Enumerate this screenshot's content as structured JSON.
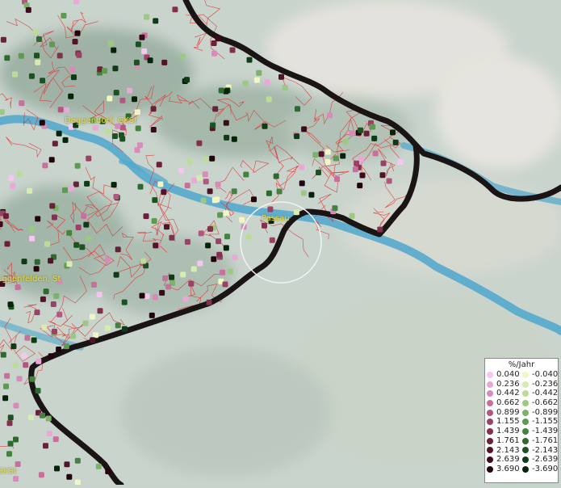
{
  "map": {
    "places": [
      {
        "key": "deggendorf",
        "name": "Deggendorf, GKSt"
      },
      {
        "key": "passau",
        "name": "Passau"
      },
      {
        "key": "eggenfelden",
        "name": "Eggenfelden, St"
      },
      {
        "key": "gkst_bottom",
        "name": "GKSt"
      }
    ]
  },
  "legend": {
    "title": "%/Jahr",
    "positive": [
      {
        "label": "0.040",
        "color": "#f4c6f0"
      },
      {
        "label": "0.236",
        "color": "#e8a8d8"
      },
      {
        "label": "0.442",
        "color": "#d88ab8"
      },
      {
        "label": "0.662",
        "color": "#c8709c"
      },
      {
        "label": "0.899",
        "color": "#b25880"
      },
      {
        "label": "1.155",
        "color": "#9a4266"
      },
      {
        "label": "1.439",
        "color": "#82304e"
      },
      {
        "label": "1.761",
        "color": "#6a2038"
      },
      {
        "label": "2.143",
        "color": "#521428"
      },
      {
        "label": "2.639",
        "color": "#3c0a1a"
      },
      {
        "label": "3.690",
        "color": "#24040c"
      }
    ],
    "negative": [
      {
        "label": "-0.040",
        "color": "#f2f6c2"
      },
      {
        "label": "-0.236",
        "color": "#d8ecb0"
      },
      {
        "label": "-0.442",
        "color": "#bcdc98"
      },
      {
        "label": "-0.662",
        "color": "#9cc884"
      },
      {
        "label": "-0.899",
        "color": "#7cb26a"
      },
      {
        "label": "-1.155",
        "color": "#5e9a52"
      },
      {
        "label": "-1.439",
        "color": "#448240"
      },
      {
        "label": "-1.761",
        "color": "#2e6a30"
      },
      {
        "label": "-2.143",
        "color": "#1c5222"
      },
      {
        "label": "-2.639",
        "color": "#0e3a16"
      },
      {
        "label": "-3.690",
        "color": "#04240a"
      }
    ]
  }
}
